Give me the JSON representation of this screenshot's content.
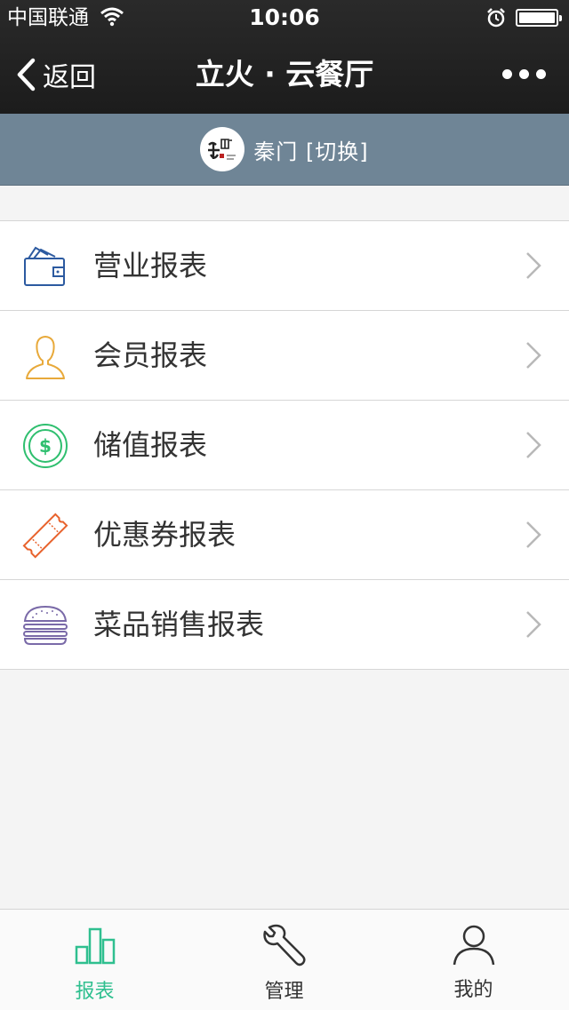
{
  "status_bar": {
    "carrier": "中国联通",
    "time": "10:06"
  },
  "nav": {
    "back_label": "返回",
    "title": "立火 · 云餐厅"
  },
  "store": {
    "name": "秦门 [切换]"
  },
  "reports": [
    {
      "label": "营业报表",
      "icon": "wallet-icon",
      "color": "#2c5aa0"
    },
    {
      "label": "会员报表",
      "icon": "member-icon",
      "color": "#e8a93a"
    },
    {
      "label": "储值报表",
      "icon": "dollar-coin-icon",
      "color": "#2fbf6f"
    },
    {
      "label": "优惠券报表",
      "icon": "coupon-icon",
      "color": "#e8622c"
    },
    {
      "label": "菜品销售报表",
      "icon": "burger-icon",
      "color": "#7a6aa8"
    }
  ],
  "tabs": [
    {
      "label": "报表",
      "icon": "bar-chart-icon",
      "active": true
    },
    {
      "label": "管理",
      "icon": "wrench-icon",
      "active": false
    },
    {
      "label": "我的",
      "icon": "user-icon",
      "active": false
    }
  ],
  "colors": {
    "accent": "#2fbf8f",
    "store_bar": "#6f8596",
    "top_bar": "#1f1f1f"
  }
}
